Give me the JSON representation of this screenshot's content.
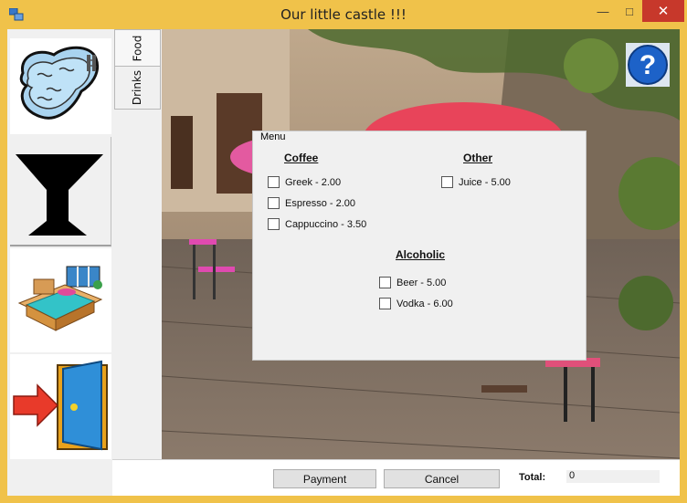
{
  "window": {
    "title": "Our little castle !!!"
  },
  "title_controls": {
    "minimize": "—",
    "maximize": "□",
    "close": "✕"
  },
  "nav": {
    "items": [
      {
        "name": "pool",
        "icon": "pool-icon"
      },
      {
        "name": "drinks",
        "icon": "cocktail-glass-icon"
      },
      {
        "name": "room",
        "icon": "bedroom-icon"
      },
      {
        "name": "exit",
        "icon": "exit-door-icon"
      }
    ]
  },
  "tabs": [
    {
      "label": "Food"
    },
    {
      "label": "Drinks"
    }
  ],
  "help": {
    "label": "?"
  },
  "menu": {
    "title": "Menu",
    "coffee": {
      "heading": "Coffee",
      "items": [
        "Greek - 2.00",
        "Espresso - 2.00",
        "Cappuccino - 3.50"
      ]
    },
    "other": {
      "heading": "Other",
      "items": [
        "Juice - 5.00"
      ]
    },
    "alcoholic": {
      "heading": "Alcoholic",
      "items": [
        "Beer - 5.00",
        "Vodka - 6.00"
      ]
    }
  },
  "footer": {
    "payment_label": "Payment",
    "cancel_label": "Cancel",
    "total_label": "Total:",
    "total_value": "0"
  },
  "colors": {
    "titlebar": "#f0c24a",
    "close": "#c7382b",
    "window_bg": "#f0f0f0"
  }
}
